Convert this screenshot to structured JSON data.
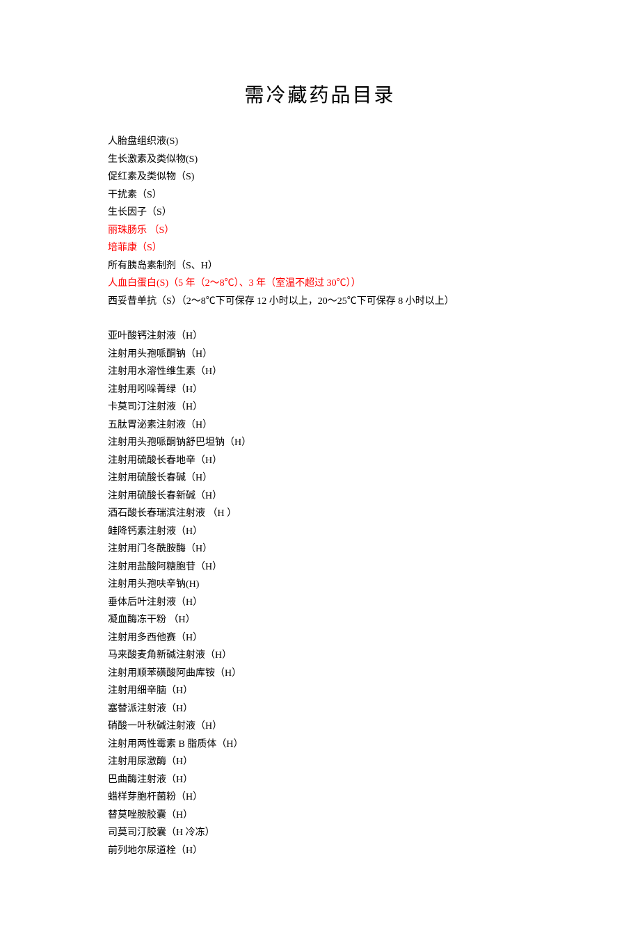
{
  "title": "需冷藏药品目录",
  "items": [
    {
      "text": "人胎盘组织液(S)",
      "red": false
    },
    {
      "text": "生长激素及类似物(S)",
      "red": false
    },
    {
      "text": "促红素及类似物（S)",
      "red": false
    },
    {
      "text": "干扰素（S）",
      "red": false
    },
    {
      "text": "生长因子（S）",
      "red": false
    },
    {
      "text": "丽珠肠乐 （S）",
      "red": true
    },
    {
      "text": "培菲康（S）",
      "red": true
    },
    {
      "text": "所有胰岛素制剂（S、H）",
      "red": false
    },
    {
      "text": "人血白蛋白(S)（5 年（2～8℃）、3 年（室温不超过 30℃））",
      "red": true
    },
    {
      "text": "西妥昔单抗（S）（2～8℃下可保存 12 小时以上，20～25℃下可保存 8 小时以上）",
      "red": false
    },
    {
      "text": "",
      "spacer": true
    },
    {
      "text": "亚叶酸钙注射液（H）",
      "red": false
    },
    {
      "text": "注射用头孢哌酮钠（H）",
      "red": false
    },
    {
      "text": "注射用水溶性维生素（H）",
      "red": false
    },
    {
      "text": "注射用吲哚菁绿（H）",
      "red": false
    },
    {
      "text": "卡莫司汀注射液（H）",
      "red": false
    },
    {
      "text": "五肽胃泌素注射液（H）",
      "red": false
    },
    {
      "text": "注射用头孢哌酮钠舒巴坦钠（H）",
      "red": false
    },
    {
      "text": "注射用硫酸长春地辛（H）",
      "red": false
    },
    {
      "text": "注射用硫酸长春碱（H）",
      "red": false
    },
    {
      "text": "注射用硫酸长春新碱（H）",
      "red": false
    },
    {
      "text": "酒石酸长春瑞滨注射液 （H ）",
      "red": false
    },
    {
      "text": "鲑降钙素注射液（H）",
      "red": false
    },
    {
      "text": "注射用门冬酰胺酶（H）",
      "red": false
    },
    {
      "text": "注射用盐酸阿糖胞苷（H）",
      "red": false
    },
    {
      "text": "注射用头孢呋辛钠(H)",
      "red": false
    },
    {
      "text": "垂体后叶注射液（H）",
      "red": false
    },
    {
      "text": "凝血酶冻干粉 （H）",
      "red": false
    },
    {
      "text": "注射用多西他赛（H）",
      "red": false
    },
    {
      "text": "马来酸麦角新碱注射液（H）",
      "red": false
    },
    {
      "text": "注射用顺苯磺酸阿曲库铵（H）",
      "red": false
    },
    {
      "text": "注射用细辛脑（H）",
      "red": false
    },
    {
      "text": "塞替派注射液（H）",
      "red": false
    },
    {
      "text": "硝酸一叶秋碱注射液（H）",
      "red": false
    },
    {
      "text": "注射用两性霉素 B 脂质体（H）",
      "red": false
    },
    {
      "text": "注射用尿激酶（H）",
      "red": false
    },
    {
      "text": "巴曲酶注射液（H）",
      "red": false
    },
    {
      "text": "蜡样芽胞杆菌粉（H）",
      "red": false
    },
    {
      "text": "替莫唑胺胶囊（H）",
      "red": false
    },
    {
      "text": "司莫司汀胶囊（H   冷冻）",
      "red": false
    },
    {
      "text": "前列地尔尿道栓（H）",
      "red": false
    }
  ]
}
